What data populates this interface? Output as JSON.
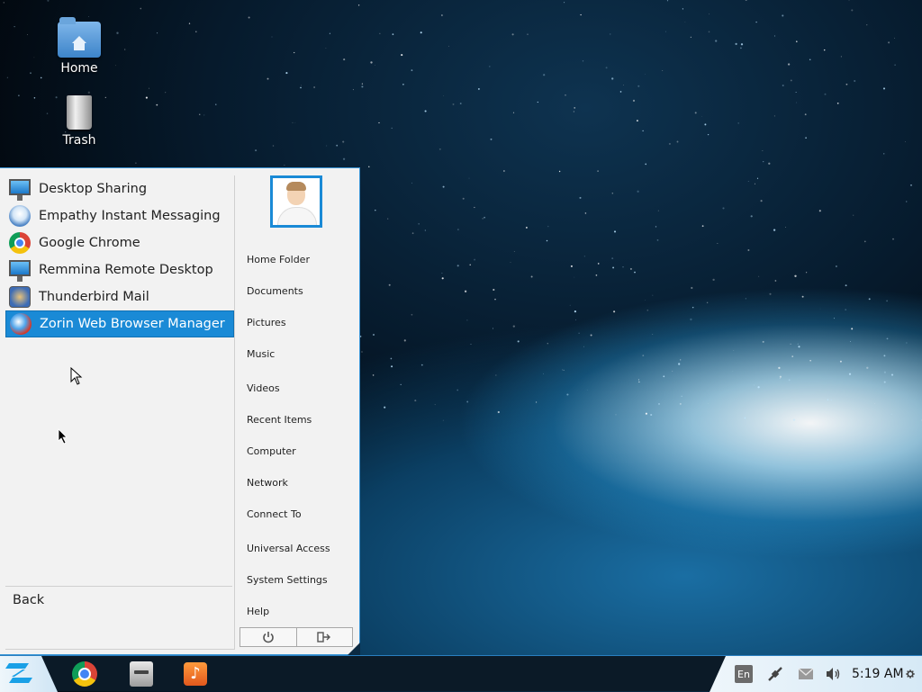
{
  "desktop": {
    "icons": [
      {
        "label": "Home",
        "icon": "home-folder-icon"
      },
      {
        "label": "Trash",
        "icon": "trash-icon"
      }
    ]
  },
  "menu": {
    "apps": [
      {
        "label": "Desktop Sharing",
        "icon": "desktop-sharing-icon",
        "selected": false
      },
      {
        "label": "Empathy Instant Messaging",
        "icon": "empathy-icon",
        "selected": false
      },
      {
        "label": "Google Chrome",
        "icon": "chrome-icon",
        "selected": false
      },
      {
        "label": "Remmina Remote Desktop",
        "icon": "remmina-icon",
        "selected": false
      },
      {
        "label": "Thunderbird Mail",
        "icon": "thunderbird-icon",
        "selected": false
      },
      {
        "label": "Zorin Web Browser Manager",
        "icon": "zorin-web-browser-manager-icon",
        "selected": true
      }
    ],
    "back_label": "Back",
    "places": [
      "Home Folder",
      "Documents",
      "Pictures",
      "Music",
      "Videos",
      "Recent Items",
      "Computer",
      "Network",
      "Connect To",
      "Universal Access",
      "System Settings",
      "Help"
    ],
    "power_icon": "power-icon",
    "logout_icon": "logout-icon"
  },
  "taskbar": {
    "start_icon": "zorin-logo-icon",
    "pinned": [
      "chrome-icon",
      "files-icon",
      "music-player-icon"
    ],
    "tray": {
      "language": "En",
      "network_icon": "network-icon",
      "mail_icon": "mail-icon",
      "volume_icon": "volume-icon",
      "clock": "5:19 AM",
      "settings_icon": "gear-icon"
    }
  },
  "colors": {
    "accent": "#1a8ad6",
    "menu_bg": "#f2f2f2",
    "taskbar_bg": "#0b1a27"
  }
}
